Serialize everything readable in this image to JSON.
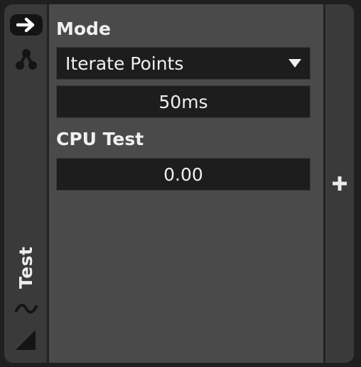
{
  "left_strip": {
    "arrow_icon": "arrow-right-icon",
    "nodes_icon": "node-graph-icon",
    "vertical_label": "Test",
    "wave_icon": "wave-icon",
    "resize_icon": "resize-corner-icon"
  },
  "content": {
    "mode_label": "Mode",
    "mode_value": "Iterate Points",
    "interval_value": "50ms",
    "cpu_label": "CPU Test",
    "cpu_value": "0.00"
  },
  "right_strip": {
    "add_icon": "plus-icon"
  },
  "colors": {
    "panel_bg": "#4a4a4a",
    "strip_bg": "#3a3a3a",
    "field_bg": "#1d1d1d",
    "text": "#f0f0f0"
  }
}
